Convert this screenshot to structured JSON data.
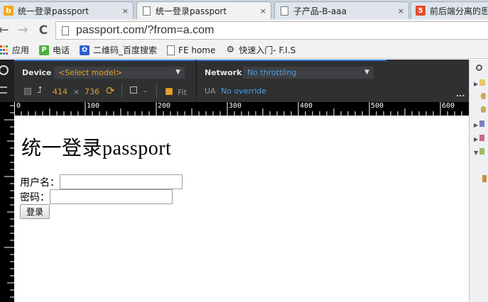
{
  "tabs": [
    {
      "title": "统一登录passport",
      "favicon": "bing-icon",
      "active": false
    },
    {
      "title": "统一登录passport",
      "favicon": "document-icon",
      "active": true
    },
    {
      "title": "子产品-B-aaa",
      "favicon": "document-icon",
      "active": false
    },
    {
      "title": "前后端分离的思",
      "favicon": "html5-icon",
      "active": false
    }
  ],
  "tab_close_glyph": "×",
  "toolbar": {
    "back_glyph": "←",
    "forward_glyph": "→",
    "reload_glyph": "C",
    "url": "passport.com/?from=a.com"
  },
  "bookmarks": [
    {
      "label": "应用",
      "icon": "apps-icon"
    },
    {
      "label": "电话",
      "icon": "phone-app-icon"
    },
    {
      "label": "二维码_百度搜索",
      "icon": "baidu-paw-icon"
    },
    {
      "label": "FE home",
      "icon": "document-icon"
    },
    {
      "label": "快速入门- F.I.S",
      "icon": "gear-icon"
    }
  ],
  "devtools": {
    "device_label": "Device",
    "device_select": "<Select model>",
    "width": "414",
    "times": "×",
    "height": "736",
    "dash": "–",
    "fit_label": "Fit",
    "network_label": "Network",
    "network_select": "No throttling",
    "ua_label": "UA",
    "ua_value": "No override",
    "more_glyph": "...",
    "accent_color": "#e1a233",
    "link_color": "#4a9ee8"
  },
  "ruler": {
    "labels": [
      "0",
      "100",
      "200",
      "300",
      "400",
      "500",
      "600"
    ]
  },
  "page": {
    "heading": "统一登录passport",
    "username_label": "用户名：",
    "username_value": "",
    "password_label": "密码：",
    "password_value": "",
    "login_button": "登录"
  }
}
